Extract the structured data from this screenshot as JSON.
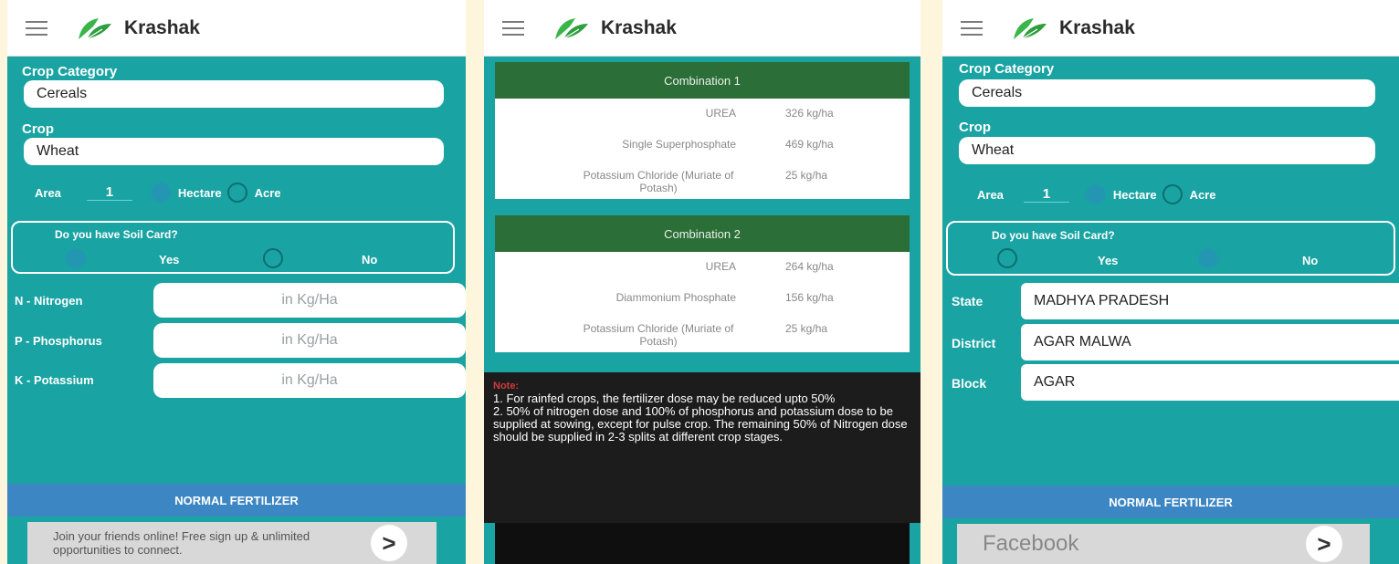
{
  "brand": {
    "name": "Krashak"
  },
  "screen1": {
    "crop_category_label": "Crop Category",
    "crop_category_value": "Cereals",
    "crop_label": "Crop",
    "crop_value": "Wheat",
    "area_label": "Area",
    "area_value": "1",
    "unit_hectare": "Hectare",
    "unit_acre": "Acre",
    "soil_question": "Do you have Soil Card?",
    "soil_yes": "Yes",
    "soil_no": "No",
    "nutrients": [
      {
        "label": "N - Nitrogen",
        "placeholder": "in Kg/Ha"
      },
      {
        "label": "P - Phosphorus",
        "placeholder": "in Kg/Ha"
      },
      {
        "label": "K - Potassium",
        "placeholder": "in Kg/Ha"
      }
    ],
    "normal_fertilizer": "NORMAL FERTILIZER",
    "ad_text": "Join your friends online! Free sign up & unlimited opportunities to connect.",
    "ad_button": ">"
  },
  "screen2": {
    "combinations": [
      {
        "title": "Combination 1",
        "rows": [
          {
            "name": "UREA",
            "value": "326 kg/ha"
          },
          {
            "name": "Single Superphosphate",
            "value": "469 kg/ha"
          },
          {
            "name": "Potassium Chloride (Muriate of Potash)",
            "value": "25 kg/ha"
          }
        ]
      },
      {
        "title": "Combination 2",
        "rows": [
          {
            "name": "UREA",
            "value": "264 kg/ha"
          },
          {
            "name": "Diammonium Phosphate",
            "value": "156 kg/ha"
          },
          {
            "name": "Potassium Chloride (Muriate of Potash)",
            "value": "25 kg/ha"
          }
        ]
      }
    ],
    "note_heading": "Note:",
    "note_lines": [
      "1. For rainfed crops, the fertilizer dose may be reduced upto 50%",
      "2. 50% of nitrogen dose and 100% of phosphorus and potassium dose to be supplied at sowing, except for pulse crop. The remaining 50% of Nitrogen dose should be supplied in 2-3 splits at different crop stages."
    ]
  },
  "screen3": {
    "crop_category_label": "Crop Category",
    "crop_category_value": "Cereals",
    "crop_label": "Crop",
    "crop_value": "Wheat",
    "area_label": "Area",
    "area_value": "1",
    "unit_hectare": "Hectare",
    "unit_acre": "Acre",
    "soil_question": "Do you have Soil Card?",
    "soil_yes": "Yes",
    "soil_no": "No",
    "state_label": "State",
    "state_value": "MADHYA PRADESH",
    "district_label": "District",
    "district_value": "AGAR MALWA",
    "block_label": "Block",
    "block_value": "AGAR",
    "normal_fertilizer": "NORMAL FERTILIZER",
    "ad_text": "Facebook",
    "ad_button": ">"
  },
  "colors": {
    "teal": "#1aa3a3",
    "green_header": "#2c6e37",
    "blue_bar": "#3c86c3",
    "note_bg": "#1c1c1c"
  },
  "icons": {
    "menu": "hamburger-menu-icon",
    "logo": "leaf-logo-icon",
    "ad_next": "chevron-right-icon"
  }
}
